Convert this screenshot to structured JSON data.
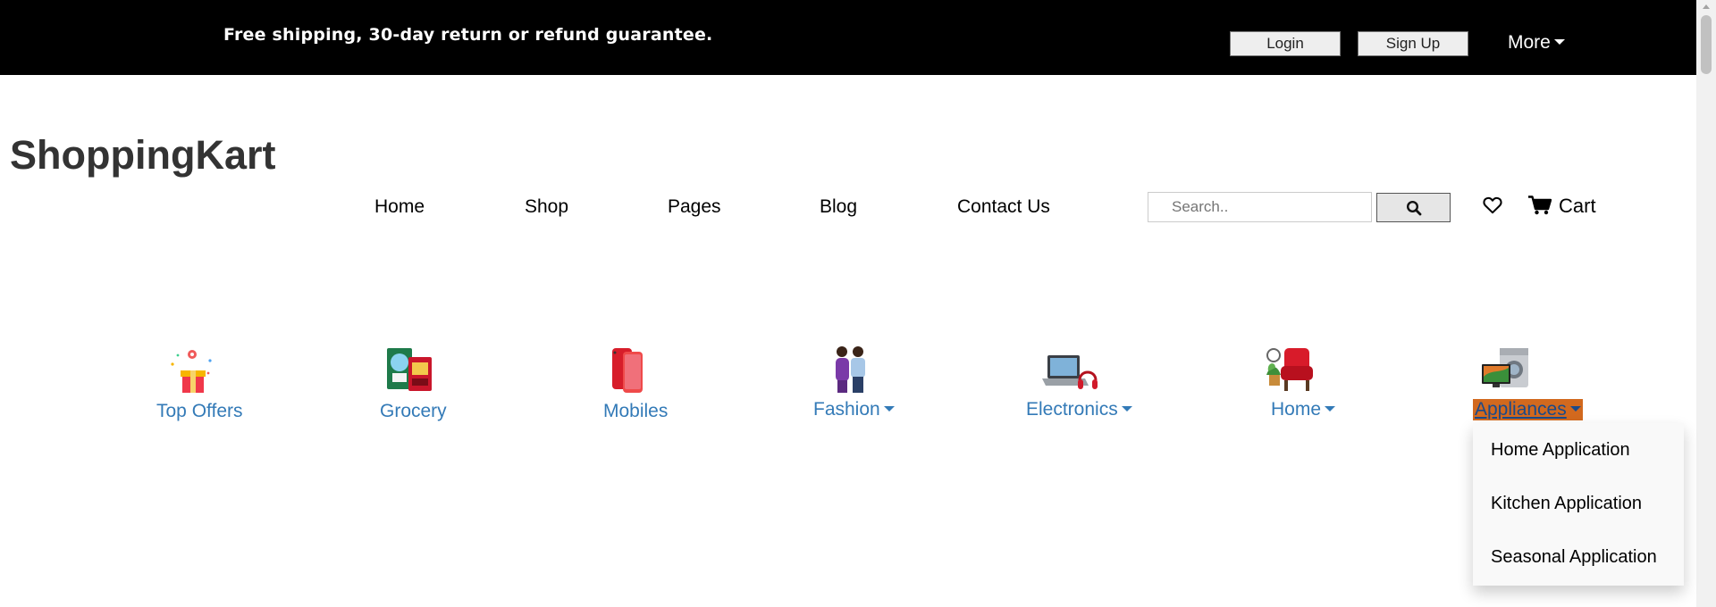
{
  "topbar": {
    "promo_text": "Free shipping, 30-day return or refund guarantee.",
    "login_label": "Login",
    "signup_label": "Sign Up",
    "more_label": "More"
  },
  "brand": "ShoppingKart",
  "nav": {
    "items": [
      "Home",
      "Shop",
      "Pages",
      "Blog",
      "Contact Us"
    ]
  },
  "search": {
    "placeholder": "Search..",
    "value": "",
    "button_icon": "search-icon"
  },
  "wishlist": {
    "icon": "heart-outline-icon"
  },
  "cart": {
    "label": "Cart",
    "icon": "shopping-cart-icon"
  },
  "categories": [
    {
      "label": "Top Offers",
      "icon": "gift-box-icon",
      "has_dropdown": false
    },
    {
      "label": "Grocery",
      "icon": "grocery-products-icon",
      "has_dropdown": false
    },
    {
      "label": "Mobiles",
      "icon": "mobile-phone-icon",
      "has_dropdown": false
    },
    {
      "label": "Fashion",
      "icon": "fashion-models-icon",
      "has_dropdown": true
    },
    {
      "label": "Electronics",
      "icon": "laptop-headphones-icon",
      "has_dropdown": true
    },
    {
      "label": "Home",
      "icon": "armchair-plant-icon",
      "has_dropdown": true
    },
    {
      "label": "Appliances",
      "icon": "tv-washing-machine-icon",
      "has_dropdown": true,
      "active": true
    }
  ],
  "appliances_menu": {
    "items": [
      "Home Application",
      "Kitchen Application",
      "Seasonal Application"
    ]
  },
  "colors": {
    "topbar_bg": "#000000",
    "category_link": "#337ab7",
    "active_highlight": "#d2691e",
    "dropdown_bg": "#f9f9f9",
    "brand_text": "#333333"
  }
}
